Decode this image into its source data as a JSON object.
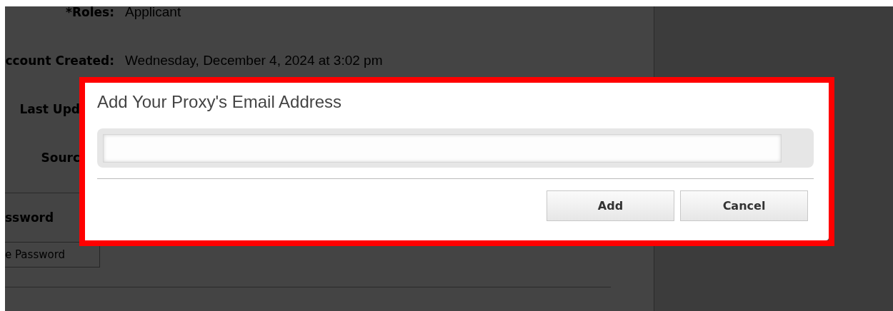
{
  "profile": {
    "fields": [
      {
        "label": "*Roles:",
        "value": "Applicant"
      },
      {
        "label": "ccount Created:",
        "value": "Wednesday, December 4, 2024 at 3:02 pm"
      },
      {
        "label": "Last Upd"
      },
      {
        "label": "Sourc"
      }
    ],
    "section_heading": "ssword",
    "change_button": "e Password"
  },
  "dialog": {
    "title": "Add Your Proxy's Email Address",
    "buttons": [
      "Add",
      "Cancel"
    ]
  }
}
